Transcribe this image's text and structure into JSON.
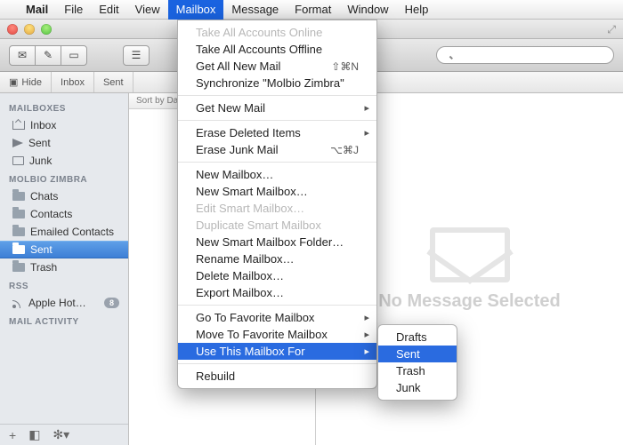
{
  "menubar": {
    "app": "Mail",
    "items": [
      "File",
      "Edit",
      "View",
      "Mailbox",
      "Message",
      "Format",
      "Window",
      "Help"
    ],
    "active_index": 3
  },
  "toolbar": {
    "search_placeholder": ""
  },
  "subbar": {
    "hide": "Hide",
    "crumbs": [
      "Inbox",
      "Sent"
    ]
  },
  "sidebar": {
    "sections": [
      {
        "header": "MAILBOXES",
        "items": [
          {
            "label": "Inbox",
            "icon": "tray"
          },
          {
            "label": "Sent",
            "icon": "send"
          },
          {
            "label": "Junk",
            "icon": "box"
          }
        ]
      },
      {
        "header": "MOLBIO ZIMBRA",
        "items": [
          {
            "label": "Chats",
            "icon": "folder"
          },
          {
            "label": "Contacts",
            "icon": "folder"
          },
          {
            "label": "Emailed Contacts",
            "icon": "folder"
          },
          {
            "label": "Sent",
            "icon": "folder",
            "selected": true
          },
          {
            "label": "Trash",
            "icon": "folder"
          }
        ]
      },
      {
        "header": "RSS",
        "items": [
          {
            "label": "Apple Hot…",
            "icon": "rss",
            "badge": "8"
          }
        ]
      },
      {
        "header": "MAIL ACTIVITY",
        "items": []
      }
    ]
  },
  "list": {
    "sort_label": "Sort by Da"
  },
  "preview": {
    "empty_text": "No Message Selected"
  },
  "menu": {
    "groups": [
      [
        {
          "label": "Take All Accounts Online",
          "disabled": true
        },
        {
          "label": "Take All Accounts Offline"
        },
        {
          "label": "Get All New Mail",
          "shortcut": "⇧⌘N"
        },
        {
          "label": "Synchronize \"Molbio Zimbra\""
        }
      ],
      [
        {
          "label": "Get New Mail",
          "submenu": true
        }
      ],
      [
        {
          "label": "Erase Deleted Items",
          "submenu": true
        },
        {
          "label": "Erase Junk Mail",
          "shortcut": "⌥⌘J"
        }
      ],
      [
        {
          "label": "New Mailbox…"
        },
        {
          "label": "New Smart Mailbox…"
        },
        {
          "label": "Edit Smart Mailbox…",
          "disabled": true
        },
        {
          "label": "Duplicate Smart Mailbox",
          "disabled": true
        },
        {
          "label": "New Smart Mailbox Folder…"
        },
        {
          "label": "Rename Mailbox…"
        },
        {
          "label": "Delete Mailbox…"
        },
        {
          "label": "Export Mailbox…"
        }
      ],
      [
        {
          "label": "Go To Favorite Mailbox",
          "submenu": true
        },
        {
          "label": "Move To Favorite Mailbox",
          "submenu": true
        },
        {
          "label": "Use This Mailbox For",
          "submenu": true,
          "highlighted": true
        }
      ],
      [
        {
          "label": "Rebuild"
        }
      ]
    ],
    "submenu": {
      "items": [
        {
          "label": "Drafts"
        },
        {
          "label": "Sent",
          "highlighted": true
        },
        {
          "label": "Trash"
        },
        {
          "label": "Junk"
        }
      ]
    }
  }
}
